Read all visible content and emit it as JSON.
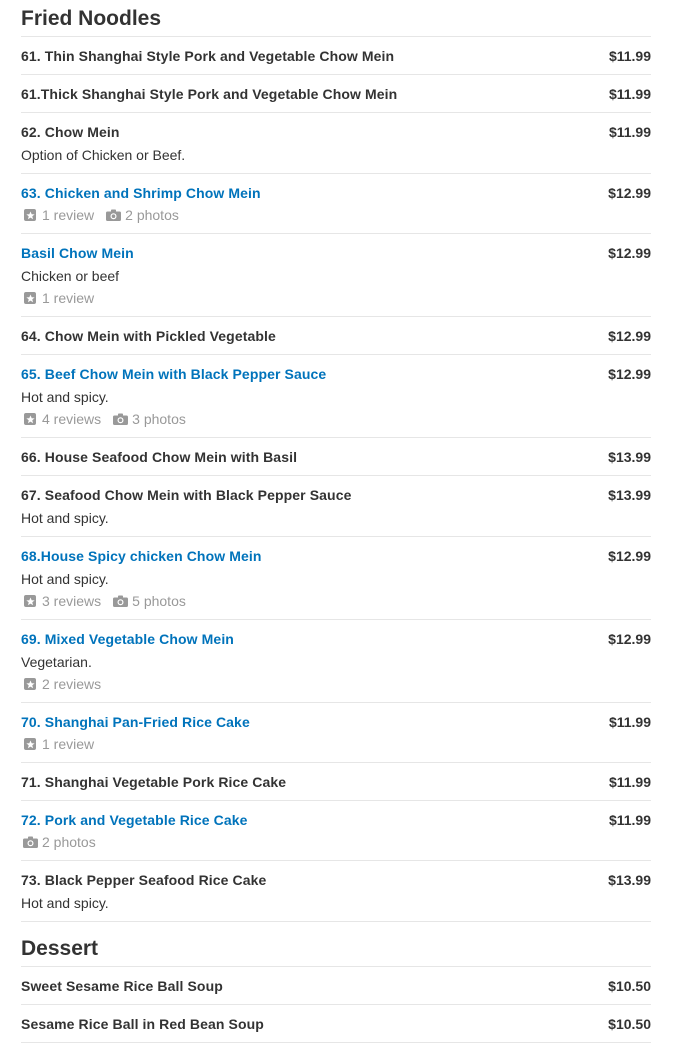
{
  "sections": [
    {
      "title": "Fried Noodles",
      "items": [
        {
          "name": "61. Thin Shanghai Style Pork and Vegetable Chow Mein",
          "price": "$11.99",
          "link": false
        },
        {
          "name": "61.Thick Shanghai Style Pork and Vegetable Chow Mein",
          "price": "$11.99",
          "link": false
        },
        {
          "name": "62. Chow Mein",
          "price": "$11.99",
          "link": false,
          "desc": "Option of Chicken or Beef."
        },
        {
          "name": "63. Chicken and Shrimp Chow Mein",
          "price": "$12.99",
          "link": true,
          "reviews": "1 review",
          "photos": "2 photos"
        },
        {
          "name": "Basil Chow Mein",
          "price": "$12.99",
          "link": true,
          "desc": "Chicken or beef",
          "reviews": "1 review"
        },
        {
          "name": "64. Chow Mein with Pickled Vegetable",
          "price": "$12.99",
          "link": false
        },
        {
          "name": "65. Beef Chow Mein with Black Pepper Sauce",
          "price": "$12.99",
          "link": true,
          "desc": "Hot and spicy.",
          "reviews": "4 reviews",
          "photos": "3 photos"
        },
        {
          "name": "66. House Seafood Chow Mein with Basil",
          "price": "$13.99",
          "link": false
        },
        {
          "name": "67. Seafood Chow Mein with Black Pepper Sauce",
          "price": "$13.99",
          "link": false,
          "desc": "Hot and spicy."
        },
        {
          "name": "68.House Spicy chicken Chow Mein",
          "price": "$12.99",
          "link": true,
          "desc": "Hot and spicy.",
          "reviews": "3 reviews",
          "photos": "5 photos"
        },
        {
          "name": "69. Mixed Vegetable Chow Mein",
          "price": "$12.99",
          "link": true,
          "desc": "Vegetarian.",
          "reviews": "2 reviews"
        },
        {
          "name": "70. Shanghai Pan-Fried Rice Cake",
          "price": "$11.99",
          "link": true,
          "reviews": "1 review"
        },
        {
          "name": "71. Shanghai Vegetable Pork Rice Cake",
          "price": "$11.99",
          "link": false
        },
        {
          "name": "72. Pork and Vegetable Rice Cake",
          "price": "$11.99",
          "link": true,
          "photos": "2 photos"
        },
        {
          "name": "73. Black Pepper Seafood Rice Cake",
          "price": "$13.99",
          "link": false,
          "desc": "Hot and spicy."
        }
      ]
    },
    {
      "title": "Dessert",
      "items": [
        {
          "name": "Sweet Sesame Rice Ball Soup",
          "price": "$10.50",
          "link": false
        },
        {
          "name": "Sesame Rice Ball in Red Bean Soup",
          "price": "$10.50",
          "link": false
        }
      ]
    }
  ],
  "icons": {
    "review": "star-icon",
    "photo": "camera-icon"
  },
  "colors": {
    "link": "#0073bb",
    "text": "#333333",
    "meta": "#999999",
    "divider": "#e6e6e6"
  }
}
